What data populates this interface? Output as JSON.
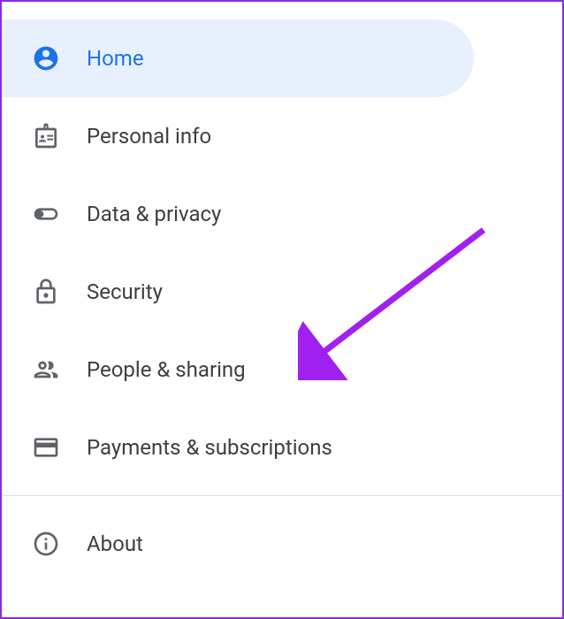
{
  "nav": {
    "items": [
      {
        "label": "Home"
      },
      {
        "label": "Personal info"
      },
      {
        "label": "Data & privacy"
      },
      {
        "label": "Security"
      },
      {
        "label": "People & sharing"
      },
      {
        "label": "Payments & subscriptions"
      },
      {
        "label": "About"
      }
    ]
  },
  "annotation": {
    "color": "#a020f0"
  }
}
